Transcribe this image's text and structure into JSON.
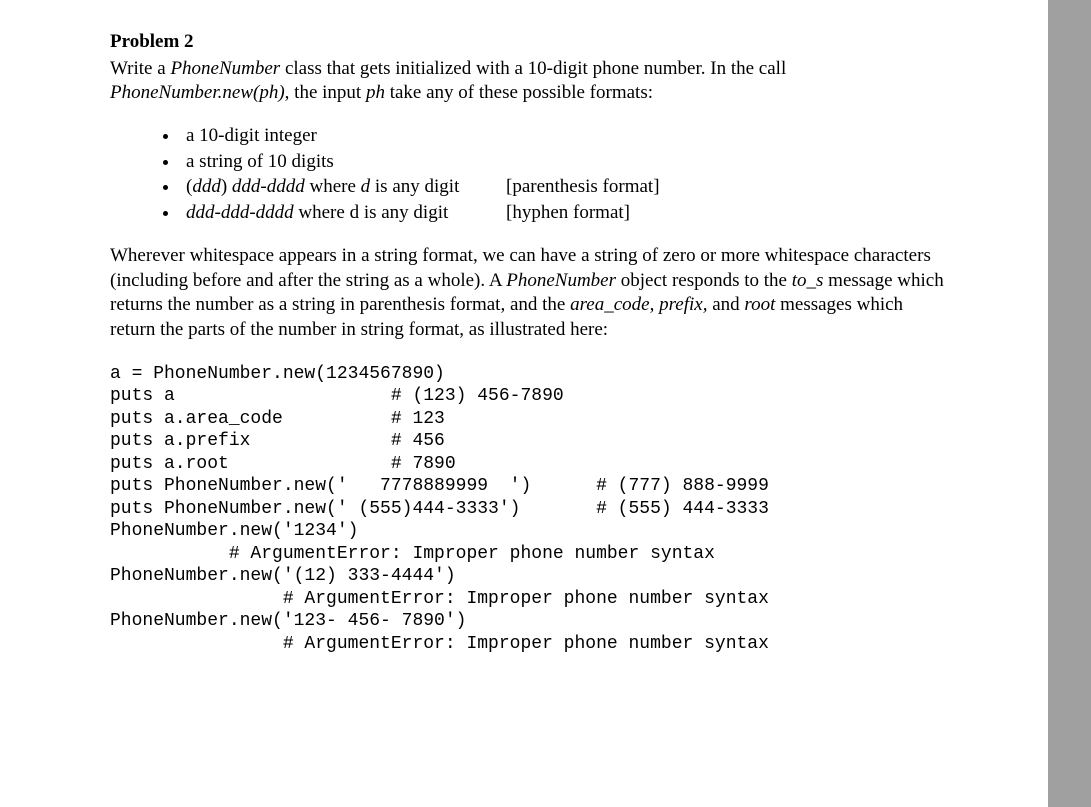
{
  "heading": "Problem 2",
  "intro_line1_a": "Write a ",
  "intro_line1_b": "PhoneNumber",
  "intro_line1_c": " class that gets initialized with a 10-digit phone number. In the call ",
  "intro_line2_a": "PhoneNumber.new(ph)",
  "intro_line2_b": ", the input ",
  "intro_line2_c": "ph",
  "intro_line2_d": " take any of these possible formats:",
  "bullets": {
    "b1": "a 10-digit integer",
    "b2": "a string of 10 digits",
    "b3_left_a": "(",
    "b3_left_b": "ddd",
    "b3_left_c": ") ",
    "b3_left_d": "ddd-dddd",
    "b3_left_e": " where ",
    "b3_left_f": "d",
    "b3_left_g": " is any digit",
    "b3_right": "[parenthesis format]",
    "b4_left_a": "ddd-ddd-dddd",
    "b4_left_b": " where d is any digit",
    "b4_right": "[hyphen format]"
  },
  "para2_a": "Wherever whitespace appears in a string format, we can have a string of zero or more whitespace characters (including before and after the string as a whole). A ",
  "para2_b": "PhoneNumber",
  "para2_c": " object responds to the ",
  "para2_d": "to_s",
  "para2_e": " message which returns the number as a string in parenthesis format, and the ",
  "para2_f": "area_code, prefix,",
  "para2_g": " and ",
  "para2_h": "root",
  "para2_i": " messages which return the parts of the number in string format, as illustrated here:",
  "code": "a = PhoneNumber.new(1234567890)\nputs a                    # (123) 456-7890\nputs a.area_code          # 123\nputs a.prefix             # 456\nputs a.root               # 7890\nputs PhoneNumber.new('   7778889999  ')      # (777) 888-9999\nputs PhoneNumber.new(' (555)444-3333')       # (555) 444-3333\nPhoneNumber.new('1234')\n           # ArgumentError: Improper phone number syntax\nPhoneNumber.new('(12) 333-4444')\n                # ArgumentError: Improper phone number syntax\nPhoneNumber.new('123- 456- 7890')\n                # ArgumentError: Improper phone number syntax"
}
